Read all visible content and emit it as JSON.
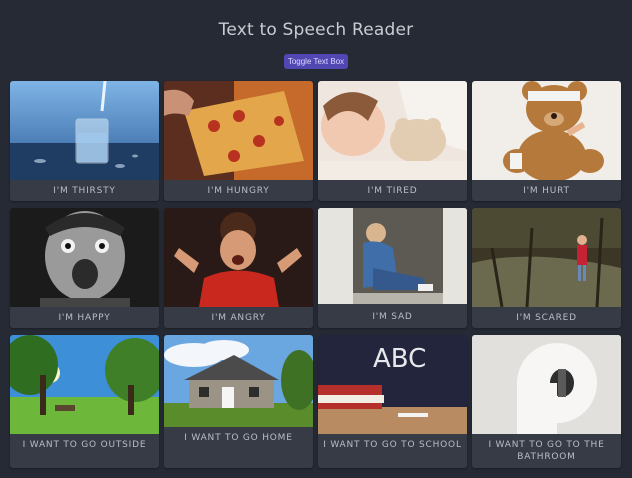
{
  "app": {
    "title": "Text to Speech Reader",
    "toggle_label": "Toggle Text Box"
  },
  "cards": [
    {
      "label": "I'M THIRSTY",
      "image": "glass-of-water-photo"
    },
    {
      "label": "I'M HUNGRY",
      "image": "pizza-slice-photo"
    },
    {
      "label": "I'M TIRED",
      "image": "sleeping-child-photo"
    },
    {
      "label": "I'M HURT",
      "image": "bandaged-teddy-bear-photo"
    },
    {
      "label": "I'M HAPPY",
      "image": "excited-boy-photo"
    },
    {
      "label": "I'M ANGRY",
      "image": "angry-boy-photo"
    },
    {
      "label": "I'M SAD",
      "image": "sad-child-in-doorway-photo"
    },
    {
      "label": "I'M SCARED",
      "image": "child-in-woods-photo"
    },
    {
      "label": "I WANT TO GO OUTSIDE",
      "image": "sunny-park-photo"
    },
    {
      "label": "I WANT TO GO HOME",
      "image": "house-photo"
    },
    {
      "label": "I WANT TO GO TO SCHOOL",
      "image": "chalkboard-abc-photo"
    },
    {
      "label": "I WANT TO GO TO THE BATHROOM",
      "image": "toilet-paper-photo"
    }
  ],
  "chalkboard_text": "ABC"
}
